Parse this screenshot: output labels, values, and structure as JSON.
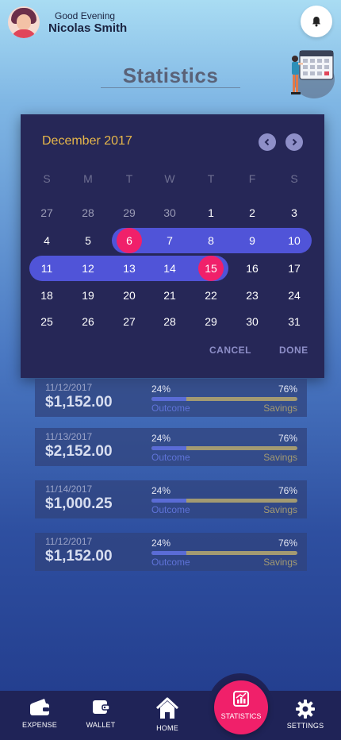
{
  "header": {
    "greeting": "Good Evening",
    "username": "Nicolas Smith",
    "bell_icon": "bell-icon"
  },
  "page": {
    "title": "Statistics"
  },
  "calendar": {
    "month_label": "December 2017",
    "prev_icon": "chevron-left-icon",
    "next_icon": "chevron-right-icon",
    "weekdays": [
      "S",
      "M",
      "T",
      "W",
      "T",
      "F",
      "S"
    ],
    "weeks": [
      [
        "27",
        "28",
        "29",
        "30",
        "1",
        "2",
        "3"
      ],
      [
        "4",
        "5",
        "6",
        "7",
        "8",
        "9",
        "10"
      ],
      [
        "11",
        "12",
        "13",
        "14",
        "15",
        "16",
        "17"
      ],
      [
        "18",
        "19",
        "20",
        "21",
        "22",
        "23",
        "24"
      ],
      [
        "25",
        "26",
        "27",
        "28",
        "29",
        "30",
        "31"
      ]
    ],
    "range_start": "6",
    "range_end": "15",
    "cancel_label": "CANCEL",
    "done_label": "DONE",
    "colors": {
      "background": "#262757",
      "accent": "#f0206a",
      "range": "#5054d8",
      "month": "#e6b64a"
    }
  },
  "transactions": [
    {
      "date": "11/12/2017",
      "amount": "$1,152.00",
      "outcome_pct": "24%",
      "savings_pct": "76%",
      "outcome_label": "Outcome",
      "savings_label": "Savings",
      "outcome_fraction": 0.24
    },
    {
      "date": "11/13/2017",
      "amount": "$2,152.00",
      "outcome_pct": "24%",
      "savings_pct": "76%",
      "outcome_label": "Outcome",
      "savings_label": "Savings",
      "outcome_fraction": 0.24
    },
    {
      "date": "11/14/2017",
      "amount": "$1,000.25",
      "outcome_pct": "24%",
      "savings_pct": "76%",
      "outcome_label": "Outcome",
      "savings_label": "Savings",
      "outcome_fraction": 0.24
    },
    {
      "date": "11/12/2017",
      "amount": "$1,152.00",
      "outcome_pct": "24%",
      "savings_pct": "76%",
      "outcome_label": "Outcome",
      "savings_label": "Savings",
      "outcome_fraction": 0.24
    }
  ],
  "bottom_nav": {
    "expense": "EXPENSE",
    "wallet": "WALLET",
    "home": "HOME",
    "statistics": "STATISTICS",
    "settings": "SETTINGS",
    "active": "statistics",
    "active_color": "#f0206a"
  }
}
